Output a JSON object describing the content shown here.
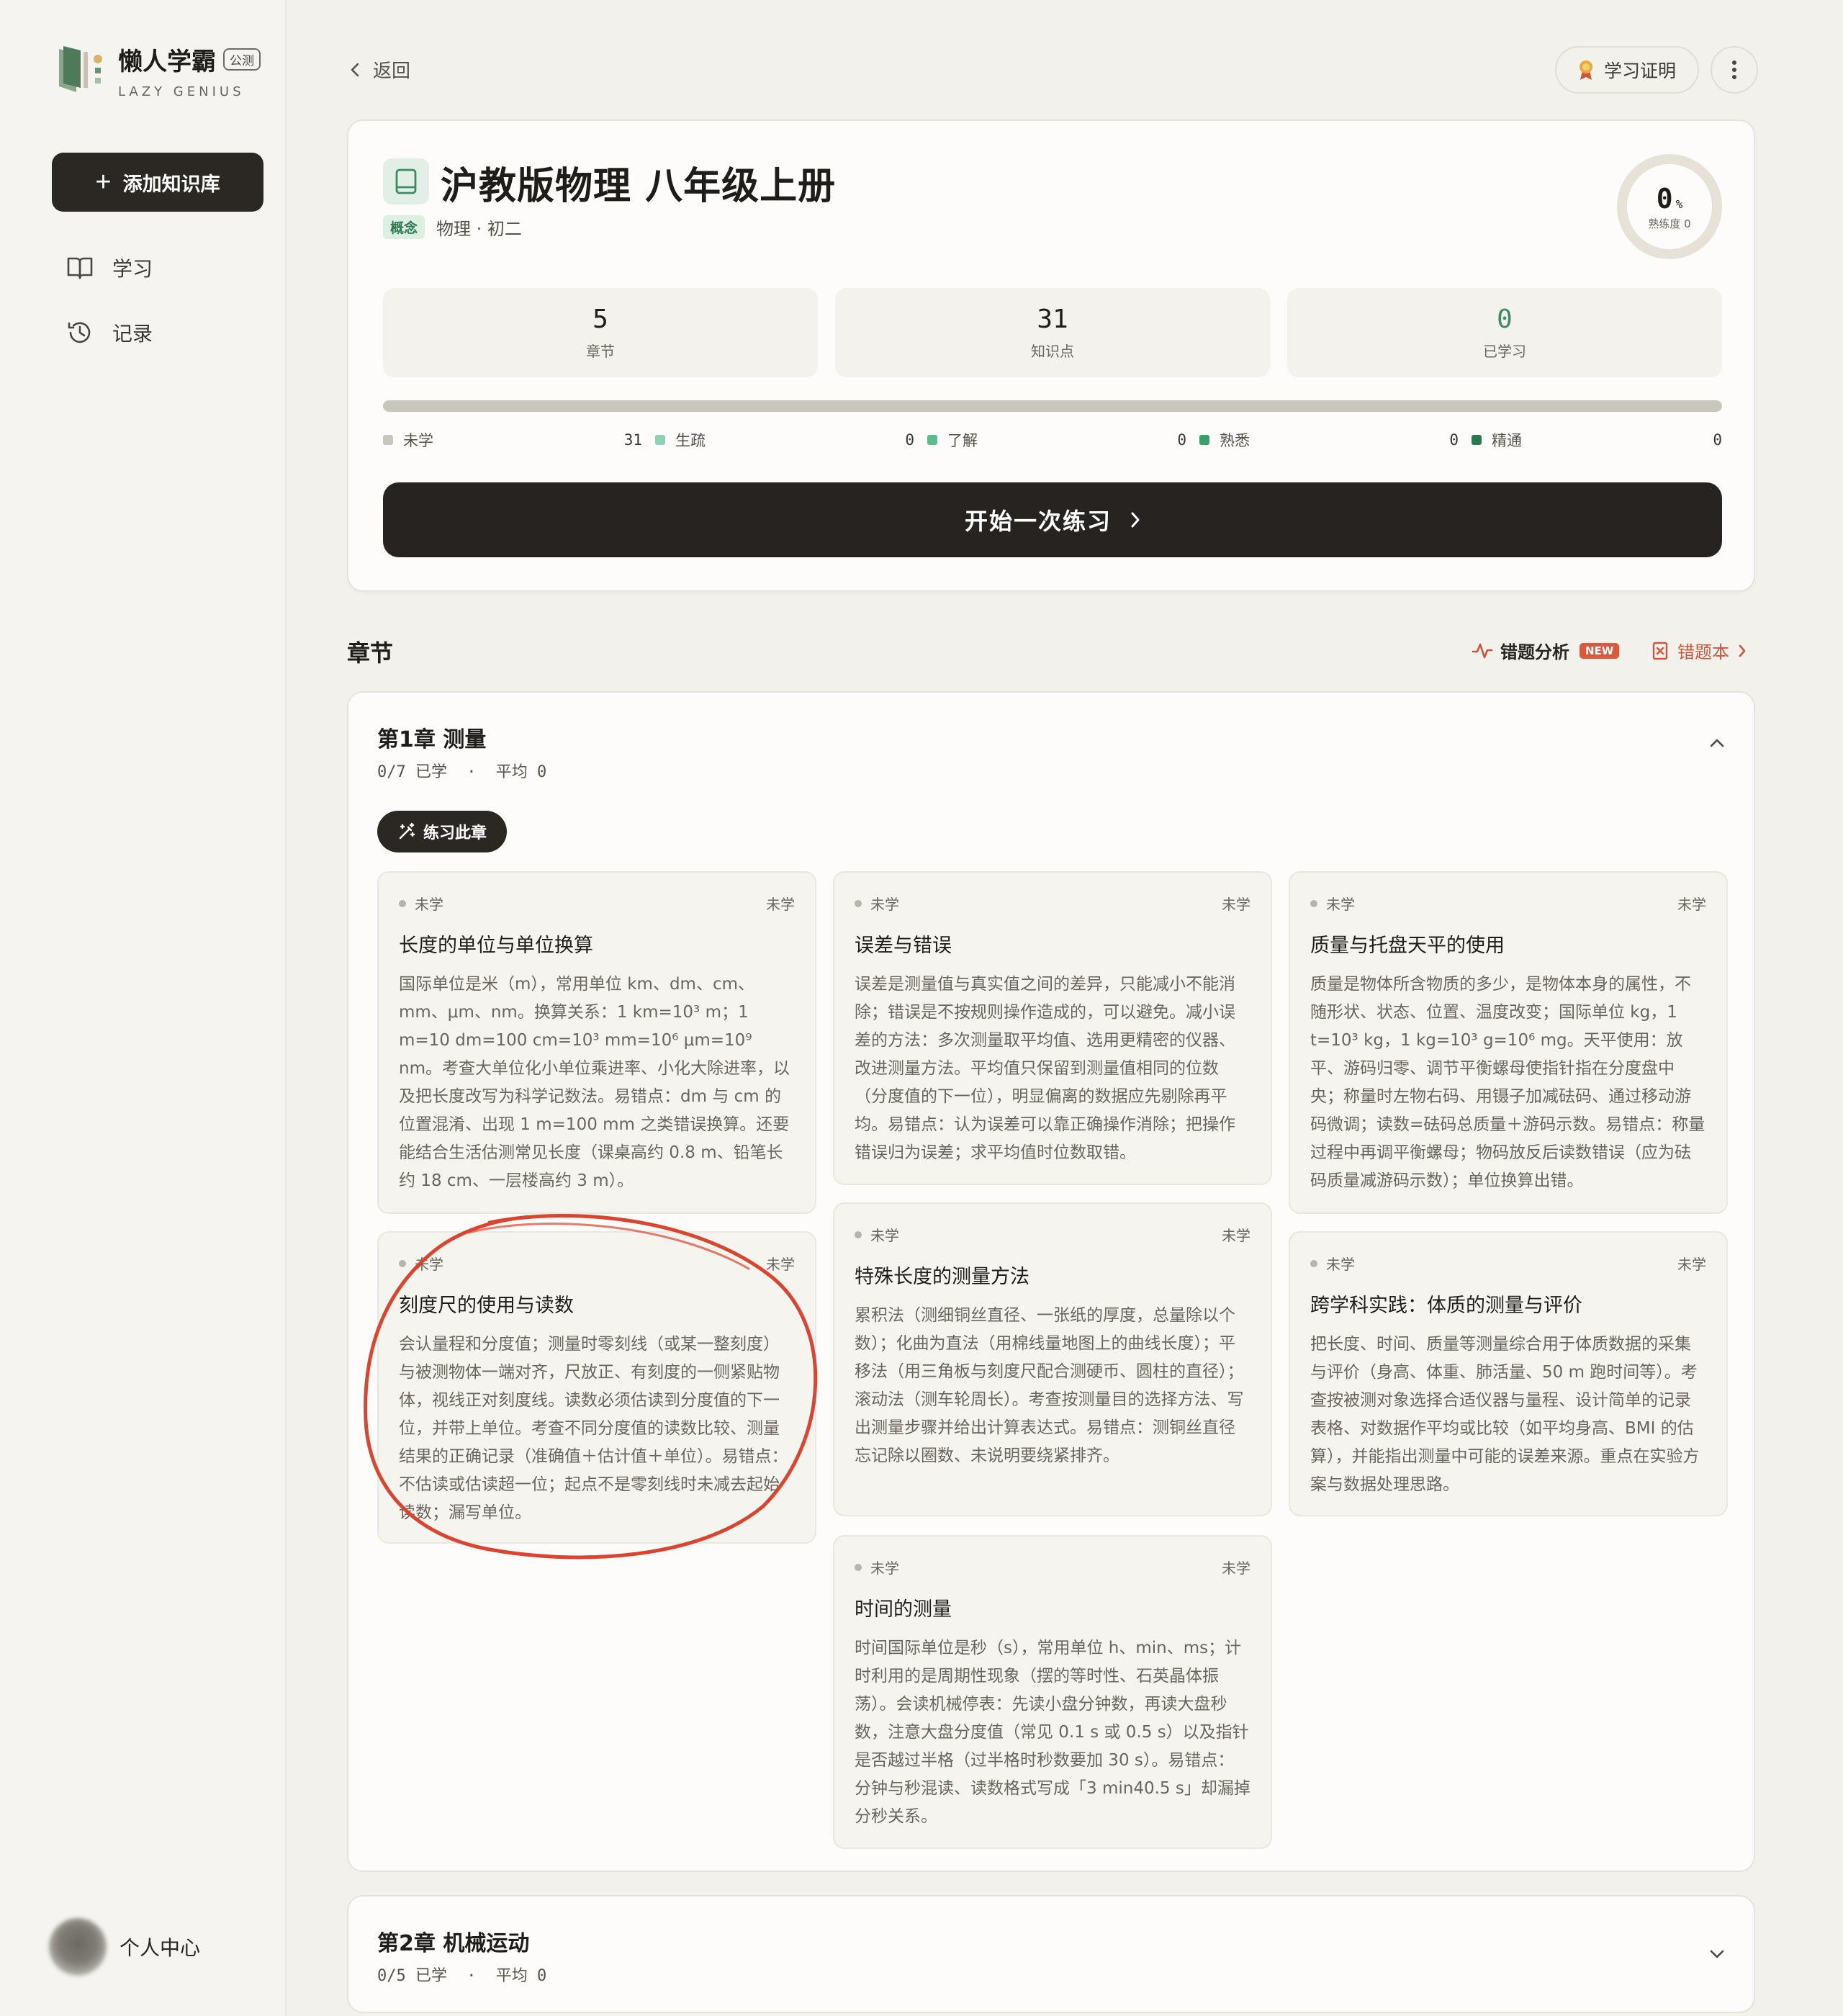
{
  "brand": {
    "name": "懒人学霸",
    "badge": "公测",
    "subtitle": "LAZY GENIUS"
  },
  "sidebar": {
    "add_label": "添加知识库",
    "items": [
      {
        "label": "学习",
        "icon": "book-open-icon"
      },
      {
        "label": "记录",
        "icon": "history-icon"
      }
    ],
    "profile_label": "个人中心"
  },
  "topbar": {
    "back_label": "返回",
    "cert_label": "学习证明"
  },
  "course": {
    "title": "沪教版物理 八年级上册",
    "tag": "概念",
    "meta": "物理 · 初二",
    "mastery": {
      "value": "0",
      "unit": "%",
      "label": "熟练度 0"
    },
    "stats": [
      {
        "value": "5",
        "label": "章节"
      },
      {
        "value": "31",
        "label": "知识点"
      },
      {
        "value": "0",
        "label": "已学习"
      }
    ],
    "legend": [
      {
        "label": "未学",
        "count": "31",
        "color": "#c9c6bd"
      },
      {
        "label": "生疏",
        "count": "0",
        "color": "#8fd1b3"
      },
      {
        "label": "了解",
        "count": "0",
        "color": "#5cbd8c"
      },
      {
        "label": "熟悉",
        "count": "0",
        "color": "#36a06a"
      },
      {
        "label": "精通",
        "count": "0",
        "color": "#2a7a4f"
      }
    ],
    "start_label": "开始一次练习"
  },
  "chapters_section": {
    "title": "章节",
    "error_analysis": "错题分析",
    "new_badge": "NEW",
    "error_book": "错题本"
  },
  "chapter1": {
    "title": "第1章 测量",
    "progress": "0/7 已学",
    "sep": "·",
    "avg": "平均 0",
    "practice_label": "练习此章",
    "points": [
      {
        "status": "未学",
        "status_right": "未学",
        "title": "长度的单位与单位换算",
        "desc": "国际单位是米（m），常用单位 km、dm、cm、mm、μm、nm。换算关系：1 km=10³ m；1 m=10 dm=100 cm=10³ mm=10⁶ μm=10⁹ nm。考查大单位化小单位乘进率、小化大除进率，以及把长度改写为科学记数法。易错点：dm 与 cm 的位置混淆、出现 1 m=100 mm 之类错误换算。还要能结合生活估测常见长度（课桌高约 0.8 m、铅笔长约 18 cm、一层楼高约 3 m）。"
      },
      {
        "status": "未学",
        "status_right": "未学",
        "title": "误差与错误",
        "desc": "误差是测量值与真实值之间的差异，只能减小不能消除；错误是不按规则操作造成的，可以避免。减小误差的方法：多次测量取平均值、选用更精密的仪器、改进测量方法。平均值只保留到测量值相同的位数（分度值的下一位），明显偏离的数据应先剔除再平均。易错点：认为误差可以靠正确操作消除；把操作错误归为误差；求平均值时位数取错。"
      },
      {
        "status": "未学",
        "status_right": "未学",
        "title": "质量与托盘天平的使用",
        "desc": "质量是物体所含物质的多少，是物体本身的属性，不随形状、状态、位置、温度改变；国际单位 kg，1 t=10³ kg，1 kg=10³ g=10⁶ mg。天平使用：放平、游码归零、调节平衡螺母使指针指在分度盘中央；称量时左物右码、用镊子加减砝码、通过移动游码微调；读数=砝码总质量＋游码示数。易错点：称量过程中再调平衡螺母；物码放反后读数错误（应为砝码质量减游码示数）；单位换算出错。"
      },
      {
        "status": "未学",
        "status_right": "未学",
        "title": "刻度尺的使用与读数",
        "desc": "会认量程和分度值；测量时零刻线（或某一整刻度）与被测物体一端对齐，尺放正、有刻度的一侧紧贴物体，视线正对刻度线。读数必须估读到分度值的下一位，并带上单位。考查不同分度值的读数比较、测量结果的正确记录（准确值＋估计值＋单位）。易错点：不估读或估读超一位；起点不是零刻线时未减去起始读数；漏写单位。"
      },
      {
        "status": "未学",
        "status_right": "未学",
        "title": "特殊长度的测量方法",
        "desc": "累积法（测细铜丝直径、一张纸的厚度，总量除以个数）；化曲为直法（用棉线量地图上的曲线长度）；平移法（用三角板与刻度尺配合测硬币、圆柱的直径）；滚动法（测车轮周长）。考查按测量目的选择方法、写出测量步骤并给出计算表达式。易错点：测铜丝直径忘记除以圈数、未说明要绕紧排齐。"
      },
      {
        "status": "未学",
        "status_right": "未学",
        "title": "跨学科实践：体质的测量与评价",
        "desc": "把长度、时间、质量等测量综合用于体质数据的采集与评价（身高、体重、肺活量、50 m 跑时间等）。考查按被测对象选择合适仪器与量程、设计简单的记录表格、对数据作平均或比较（如平均身高、BMI 的估算），并能指出测量中可能的误差来源。重点在实验方案与数据处理思路。"
      },
      {
        "status": "未学",
        "status_right": "未学",
        "title": "时间的测量",
        "desc": "时间国际单位是秒（s），常用单位 h、min、ms；计时利用的是周期性现象（摆的等时性、石英晶体振荡）。会读机械停表：先读小盘分钟数，再读大盘秒数，注意大盘分度值（常见 0.1 s 或 0.5 s）以及指针是否越过半格（过半格时秒数要加 30 s）。易错点：分钟与秒混读、读数格式写成「3 min40.5 s」却漏掉分秒关系。"
      }
    ]
  },
  "chapter2": {
    "title": "第2章 机械运动",
    "progress": "0/5 已学",
    "sep": "·",
    "avg": "平均 0"
  },
  "colors": {
    "accent_dark": "#2b2722",
    "accent_green": "#3b8c62",
    "accent_red": "#d0553a",
    "annotation_red": "#d9452e"
  }
}
